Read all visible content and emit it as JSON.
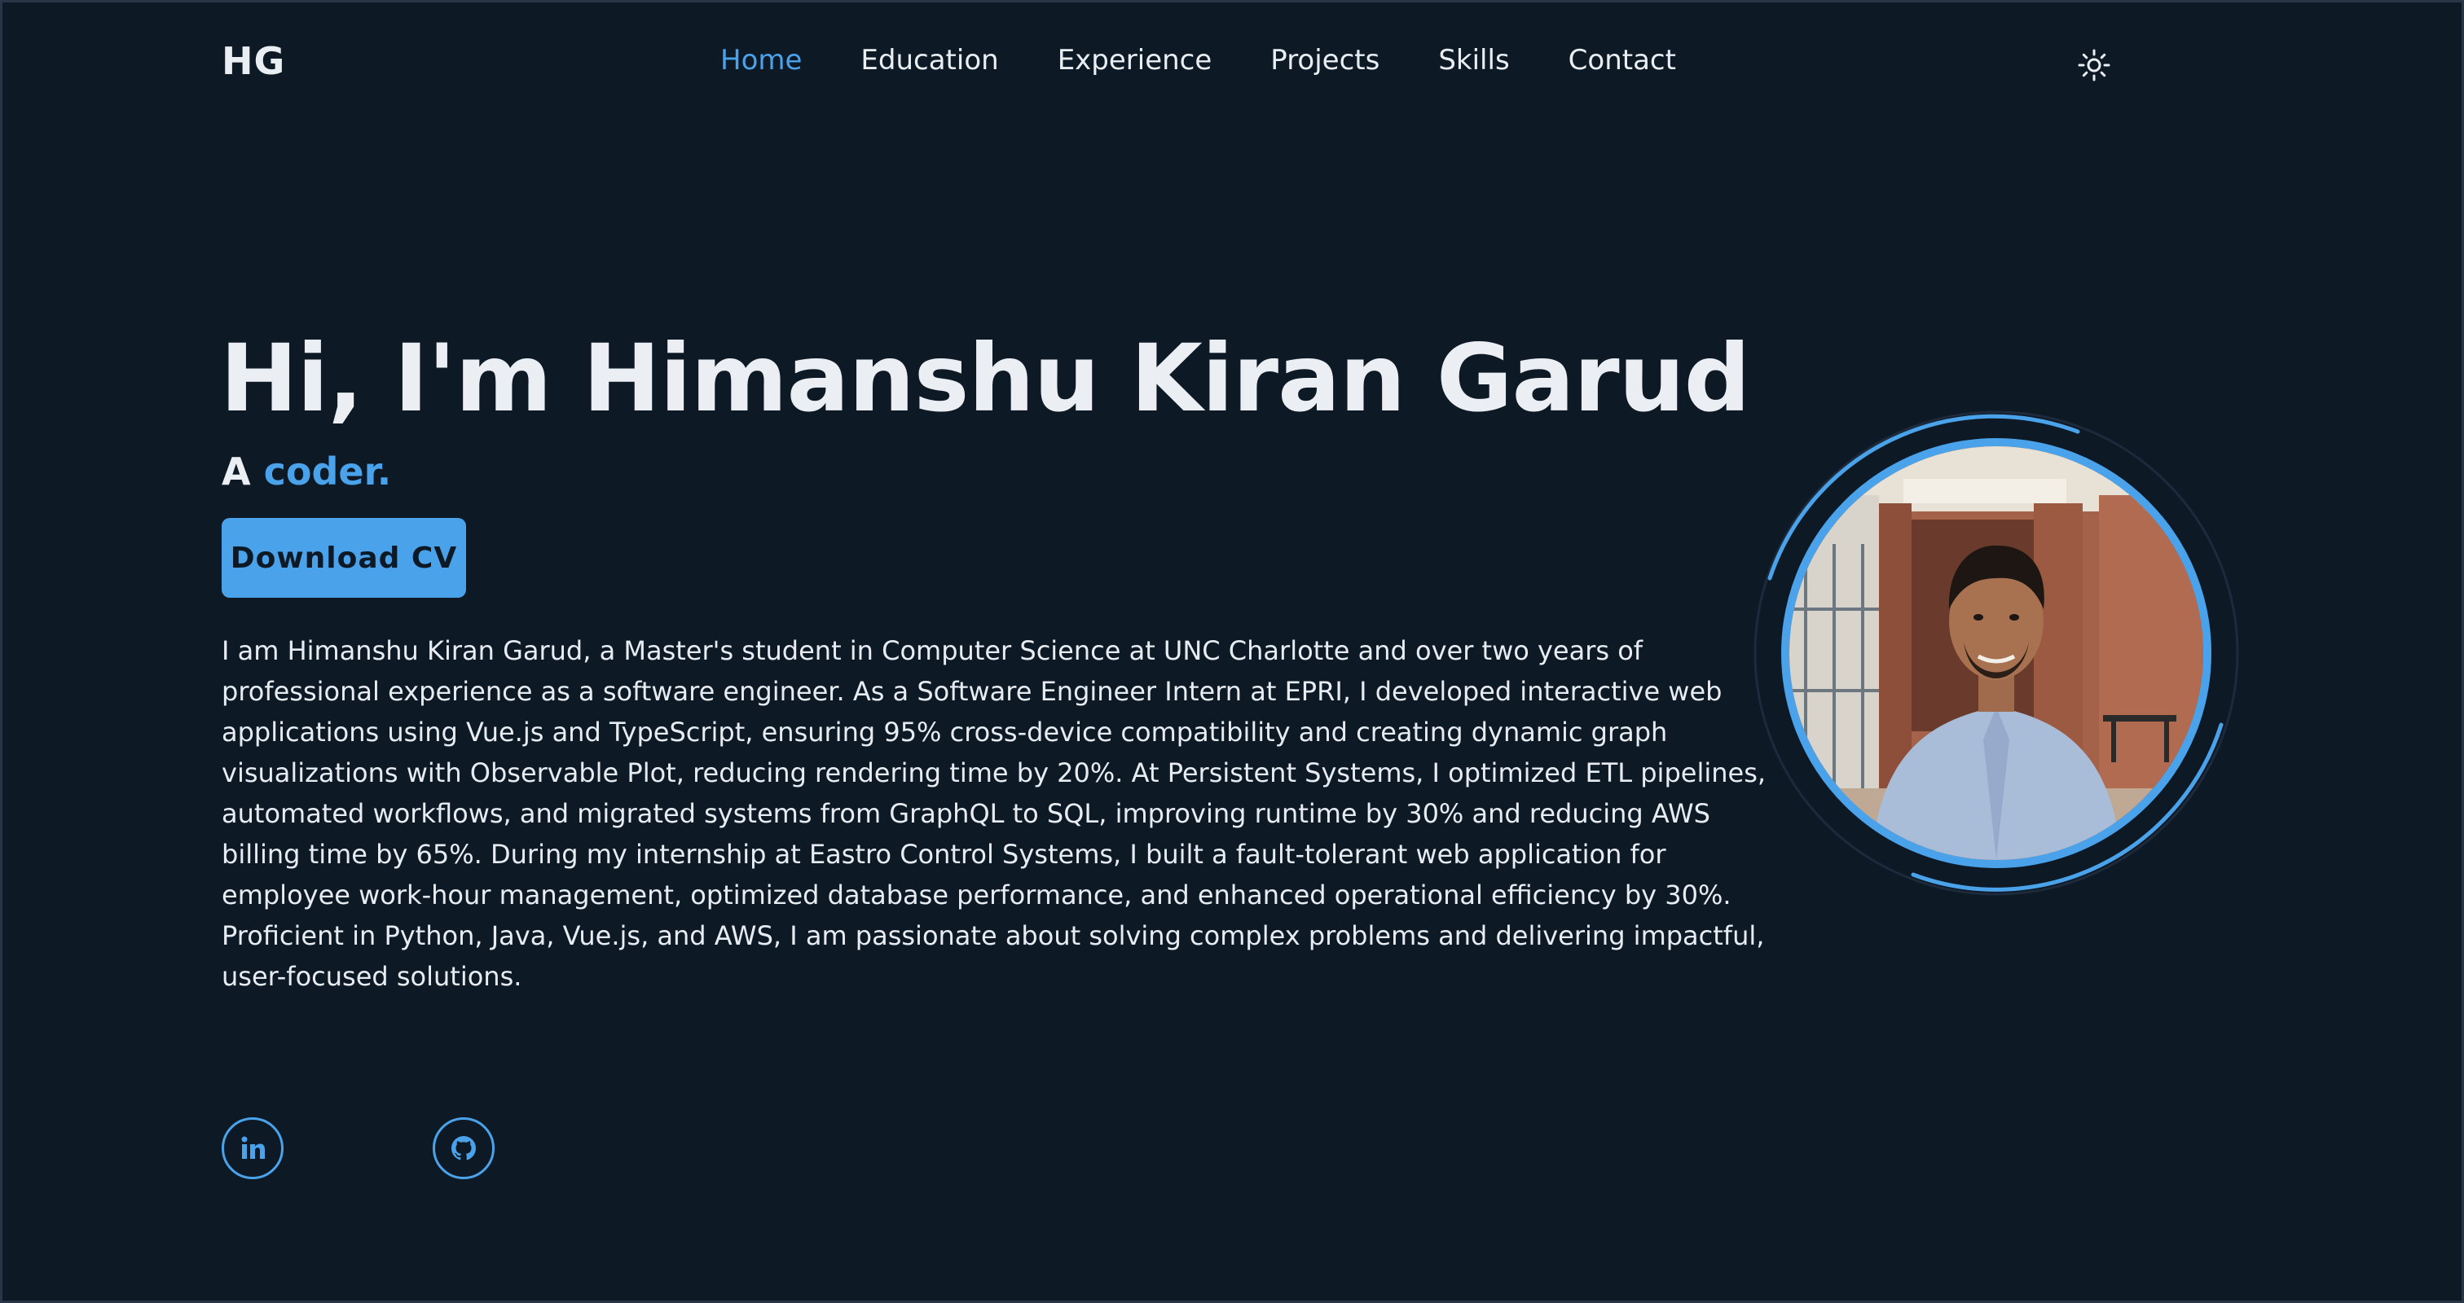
{
  "header": {
    "logo": "HG",
    "nav": [
      {
        "label": "Home",
        "active": true
      },
      {
        "label": "Education"
      },
      {
        "label": "Experience"
      },
      {
        "label": "Projects"
      },
      {
        "label": "Skills"
      },
      {
        "label": "Contact"
      }
    ],
    "theme_icon": "sun-icon"
  },
  "hero": {
    "title": "Hi, I'm Himanshu Kiran Garud",
    "subtitle_prefix": "A ",
    "subtitle_accent": "coder.",
    "cv_button": "Download CV",
    "bio": "I am Himanshu Kiran Garud, a Master's student in Computer Science at UNC Charlotte and over two years of professional experience as a software engineer. As a Software Engineer Intern at EPRI, I developed interactive web applications using Vue.js and TypeScript, ensuring 95% cross-device compatibility and creating dynamic graph visualizations with Observable Plot, reducing rendering time by 20%. At Persistent Systems, I optimized ETL pipelines, automated workflows, and migrated systems from GraphQL to SQL, improving runtime by 30% and reducing AWS billing time by 65%. During my internship at Eastro Control Systems, I built a fault-tolerant web application for employee work-hour management, optimized database performance, and enhanced operational efficiency by 30%. Proficient in Python, Java, Vue.js, and AWS, I am passionate about solving complex problems and delivering impactful, user-focused solutions."
  },
  "social": [
    {
      "icon": "linkedin-icon"
    },
    {
      "icon": "github-icon"
    }
  ],
  "colors": {
    "background": "#0e1926",
    "accent": "#4aa3ea",
    "text": "#e6ecf2"
  }
}
